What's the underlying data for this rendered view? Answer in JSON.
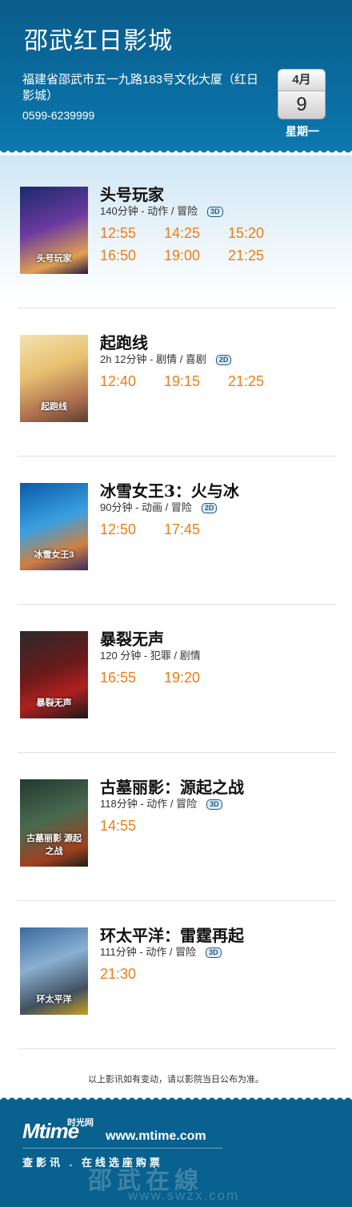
{
  "cinema": {
    "name": "邵武红日影城",
    "address": "福建省邵武市五一九路183号文化大厦（红日影城）",
    "phone": "0599-6239999"
  },
  "date": {
    "month": "4月",
    "day": "9",
    "weekday": "星期一"
  },
  "movies": [
    {
      "title": "头号玩家",
      "meta": "140分钟 - 动作 / 冒险",
      "format": "3D",
      "poster_text": "头号玩家",
      "times": [
        "12:55",
        "14:25",
        "15:20",
        "16:50",
        "19:00",
        "21:25"
      ]
    },
    {
      "title": "起跑线",
      "meta": "2h 12分钟 - 剧情 / 喜剧",
      "format": "2D",
      "poster_text": "起跑线",
      "times": [
        "12:40",
        "19:15",
        "21:25"
      ]
    },
    {
      "title": "冰雪女王3：火与冰",
      "meta": "90分钟 - 动画 / 冒险",
      "format": "2D",
      "poster_text": "冰雪女王3",
      "times": [
        "12:50",
        "17:45"
      ]
    },
    {
      "title": "暴裂无声",
      "meta": "120 分钟 - 犯罪 / 剧情",
      "format": "",
      "poster_text": "暴裂无声",
      "times": [
        "16:55",
        "19:20"
      ]
    },
    {
      "title": "古墓丽影：源起之战",
      "meta": "118分钟 - 动作 / 冒险",
      "format": "3D",
      "poster_text": "古墓丽影 源起之战",
      "times": [
        "14:55"
      ]
    },
    {
      "title": "环太平洋：雷霆再起",
      "meta": "111分钟 - 动作 / 冒险",
      "format": "3D",
      "poster_text": "环太平洋",
      "times": [
        "21:30"
      ]
    }
  ],
  "notice": "以上影讯如有变动，请以影院当日公布为准。",
  "footer": {
    "logo": "Mtime",
    "logo_cn": "时光网",
    "site": "www.mtime.com",
    "slogan": "查影讯 . 在线选座购票",
    "watermark": "邵武在線",
    "watermark_url": "www.swzx.com"
  },
  "colors": {
    "header": "#0a6b9e",
    "time": "#ee7d16",
    "footer": "#08618f"
  }
}
